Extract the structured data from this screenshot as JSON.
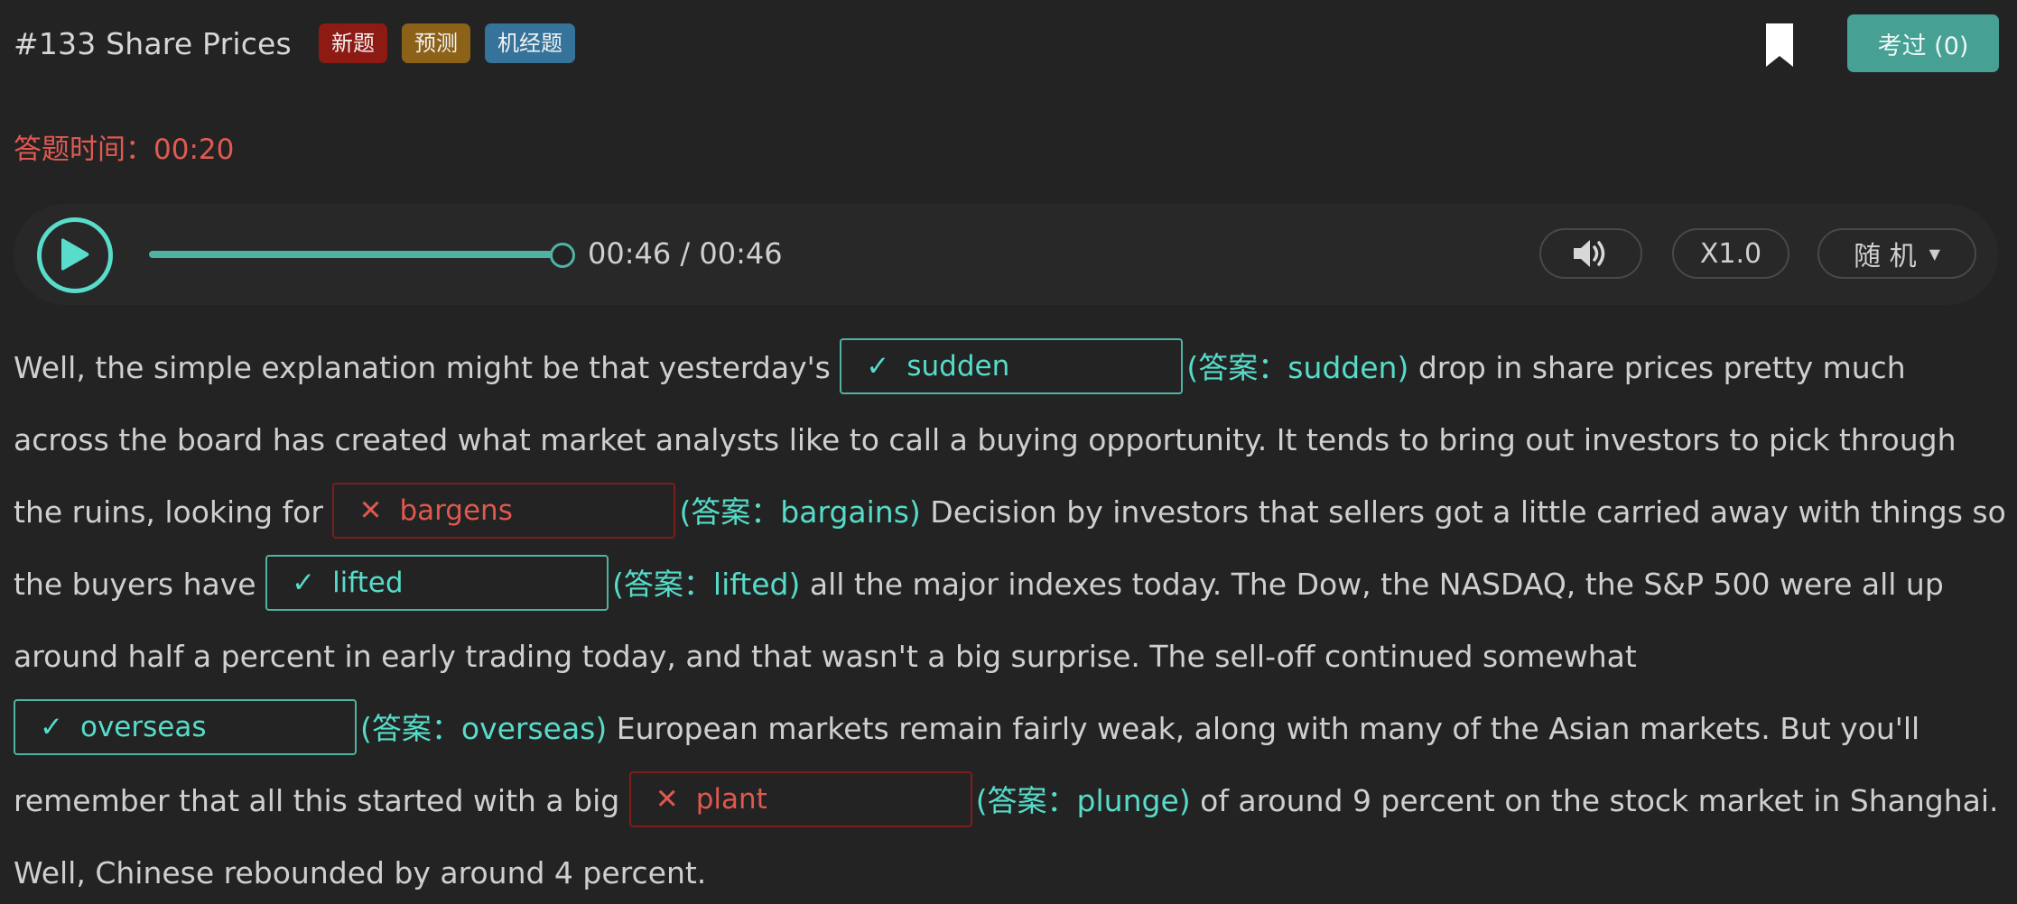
{
  "header": {
    "title": "#133 Share Prices",
    "tags": [
      "新题",
      "预测",
      "机经题"
    ],
    "exam_button": "考过 (0)"
  },
  "timer": {
    "text": "答题时间：00:20"
  },
  "player": {
    "time": "00:46 / 00:46",
    "progress": 1.0,
    "speed": "X1.0",
    "mode": "随 机"
  },
  "passage": {
    "t1": "Well, the simple explanation might be that yesterday's ",
    "b1": {
      "mark": "✓",
      "value": "sudden"
    },
    "a1": "(答案：sudden)",
    "t2": " drop in share prices pretty much across the board has created what market analysts like to call a buying opportunity. It tends to bring out investors to pick through the ruins, looking for ",
    "b2": {
      "mark": "✕",
      "value": "bargens"
    },
    "a2": "(答案：bargains)",
    "t3": " Decision by investors that sellers got a little carried away with things so the buyers have ",
    "b3": {
      "mark": "✓",
      "value": "lifted"
    },
    "a3": "(答案：lifted)",
    "t4": " all the major indexes today. The Dow, the NASDAQ, the S&P 500 were all up around half a percent in early trading today, and that wasn't a big surprise. The sell-off continued somewhat",
    "b4": {
      "mark": "✓",
      "value": "overseas"
    },
    "a4": "(答案：overseas)",
    "t5": " European markets remain fairly weak, along with many of the Asian markets. But you'll remember that all this started with a big ",
    "b5": {
      "mark": "✕",
      "value": "plant"
    },
    "a5": "(答案：plunge)",
    "t6": " of around 9 percent on the stock market in Shanghai. Well, Chinese rebounded by around 4 percent."
  }
}
